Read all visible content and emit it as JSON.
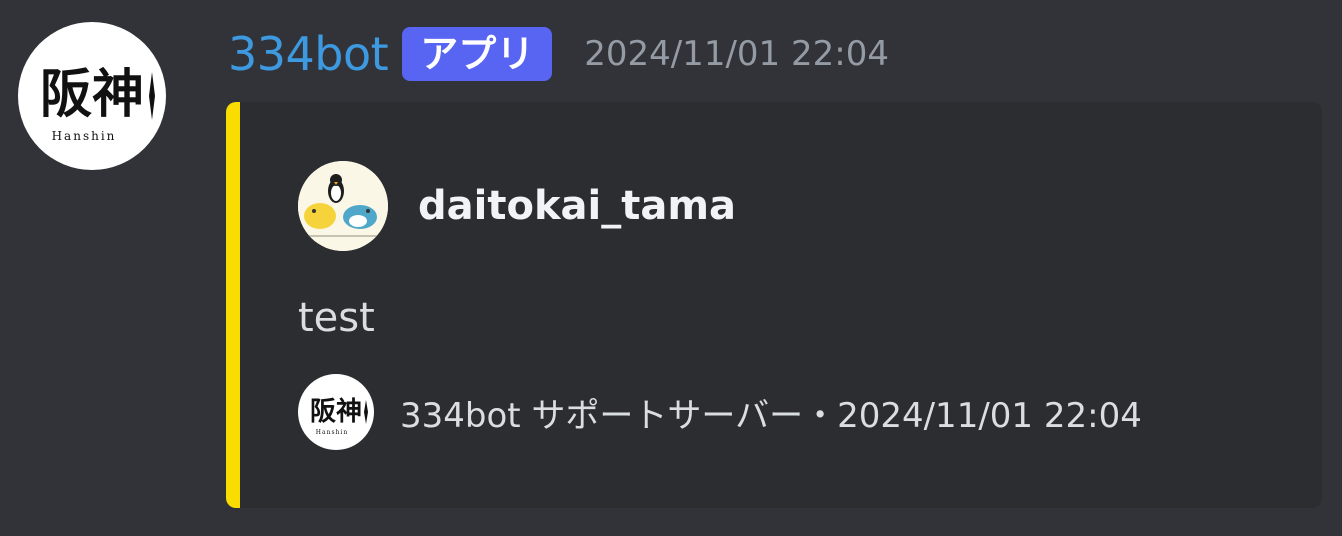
{
  "message": {
    "username": "334bot",
    "badge": "アプリ",
    "timestamp": "2024/11/01 22:04",
    "avatar_logo_text": "阪神",
    "avatar_logo_subtext": "Hanshin"
  },
  "embed": {
    "accent_color": "#f9dc00",
    "author_name": "daitokai_tama",
    "description": "test",
    "footer_text": "334bot サポートサーバー・2024/11/01 22:04",
    "footer_logo_text": "阪神",
    "footer_logo_subtext": "Hanshin"
  },
  "colors": {
    "background": "#323339",
    "embed_background": "#2b2d31",
    "username": "#3e9ae0",
    "badge": "#5865f2",
    "timestamp": "#949ba4"
  }
}
